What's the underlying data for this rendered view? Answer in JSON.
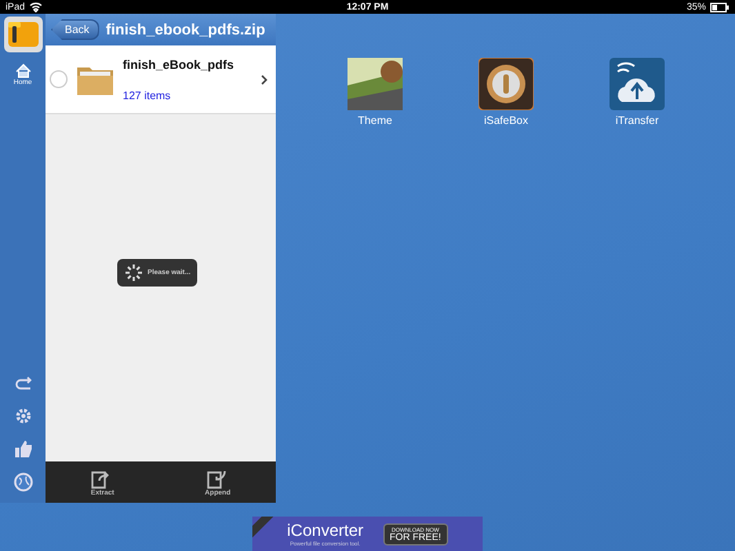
{
  "status_bar": {
    "device": "iPad",
    "time": "12:07 PM",
    "battery": "35%"
  },
  "sidebar": {
    "home_label": "Home"
  },
  "panel": {
    "back": "Back",
    "title": "finish_ebook_pdfs.zip",
    "items": [
      {
        "name": "finish_eBook_pdfs",
        "count": "127 items",
        "selected": false
      }
    ],
    "loading": "Please wait...",
    "toolbar": [
      {
        "label": "Extract",
        "kind": "extract"
      },
      {
        "label": "Append",
        "kind": "append"
      }
    ]
  },
  "desktop_apps": [
    {
      "label": "Theme",
      "kind": "theme"
    },
    {
      "label": "iSafeBox",
      "kind": "safe"
    },
    {
      "label": "iTransfer",
      "kind": "transfer"
    }
  ],
  "ad": {
    "title": "iConverter",
    "subtitle": "Powerful file conversion tool.",
    "cta_top": "DOWNLOAD NOW",
    "cta_bottom": "FOR FREE!"
  }
}
